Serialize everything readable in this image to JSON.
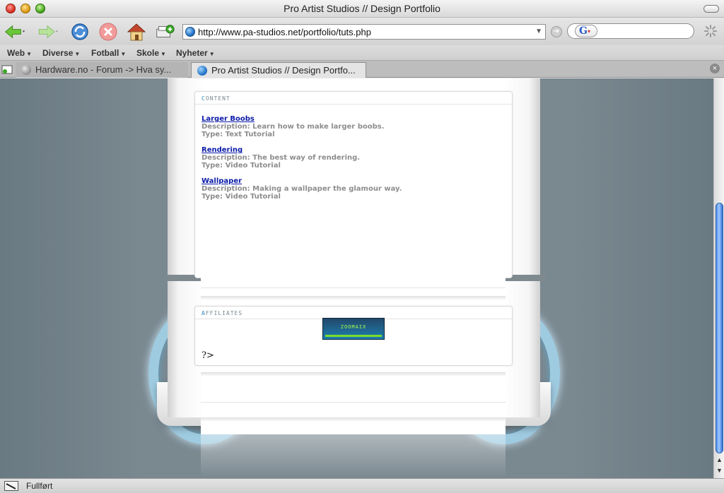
{
  "window": {
    "title": "Pro Artist Studios // Design Portfolio"
  },
  "navigation": {
    "url": "http://www.pa-studios.net/portfolio/tuts.php",
    "search_engine_icon": "google-icon",
    "search_value": ""
  },
  "bookmarks": [
    {
      "label": "Web"
    },
    {
      "label": "Diverse"
    },
    {
      "label": "Fotball"
    },
    {
      "label": "Skole"
    },
    {
      "label": "Nyheter"
    }
  ],
  "tabs": [
    {
      "label": "Hardware.no - Forum -> Hva sy...",
      "active": false
    },
    {
      "label": "Pro Artist Studios // Design Portfo...",
      "active": true
    }
  ],
  "page": {
    "content_header": "Content",
    "affiliates_header": "Affiliates",
    "tutorials": [
      {
        "title": "Larger Boobs",
        "description": "Description: Learn how to make larger boobs.",
        "type": "Type: Text Tutorial"
      },
      {
        "title": "Rendering",
        "description": "Description: The best way of rendering.",
        "type": "Type: Video Tutorial"
      },
      {
        "title": "Wallpaper",
        "description": "Description: Making a wallpaper the glamour way.",
        "type": "Type: Video Tutorial"
      }
    ],
    "affiliate_banner": "ZOOMAIX",
    "raw_code": "?>"
  },
  "status": {
    "text": "Fullført"
  },
  "colors": {
    "link": "#0a1aa8",
    "page_bg": "#6b7b83",
    "accent_ring": "#9fcbe1"
  }
}
